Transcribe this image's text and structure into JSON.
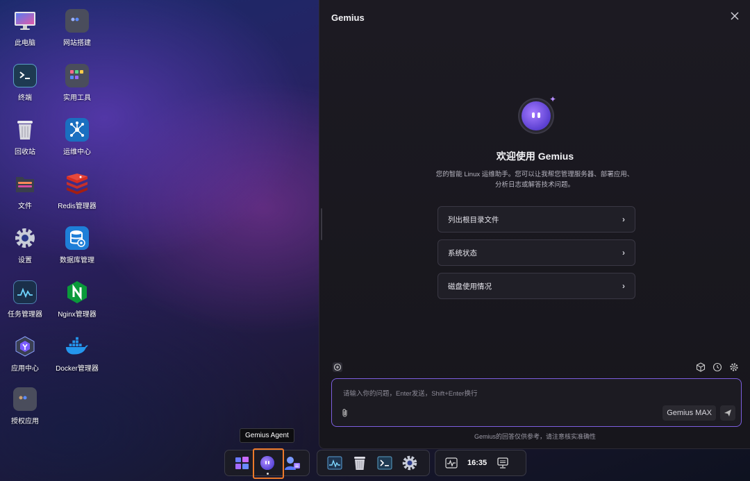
{
  "desktop": {
    "icons": [
      {
        "label": "此电脑",
        "icon": "monitor-icon"
      },
      {
        "label": "网站搭建",
        "icon": "folder-icon"
      },
      {
        "label": "终端",
        "icon": "terminal-icon"
      },
      {
        "label": "实用工具",
        "icon": "folder-apps-icon"
      },
      {
        "label": "回收站",
        "icon": "trash-icon"
      },
      {
        "label": "运维中心",
        "icon": "network-icon"
      },
      {
        "label": "文件",
        "icon": "folder-file-icon"
      },
      {
        "label": "Redis管理器",
        "icon": "redis-icon"
      },
      {
        "label": "设置",
        "icon": "gear-icon"
      },
      {
        "label": "数据库管理",
        "icon": "database-icon"
      },
      {
        "label": "任务管理器",
        "icon": "activity-icon"
      },
      {
        "label": "Nginx管理器",
        "icon": "nginx-icon"
      },
      {
        "label": "应用中心",
        "icon": "app-center-icon"
      },
      {
        "label": "Docker管理器",
        "icon": "docker-icon"
      },
      {
        "label": "授权应用",
        "icon": "folder-auth-icon"
      }
    ]
  },
  "panel": {
    "title": "Gemius",
    "welcome_title": "欢迎使用 Gemius",
    "welcome_desc_line1": "您的智能 Linux 运维助手。您可以让我帮您管理服务器、部署应用、",
    "welcome_desc_line2": "分析日志或解答技术问题。",
    "suggestions": [
      "列出根目录文件",
      "系统状态",
      "磁盘使用情况"
    ],
    "input_placeholder": "请输入你的问题，Enter发送，Shift+Enter换行",
    "model_label": "Gemius MAX",
    "disclaimer": "Gemius的回答仅供参考，请注意核实准确性",
    "accent": "#7d5fe0"
  },
  "tooltip": {
    "text": "Gemius Agent"
  },
  "taskbar": {
    "clock": "16:35",
    "active_accent": "#ee7a2a"
  }
}
